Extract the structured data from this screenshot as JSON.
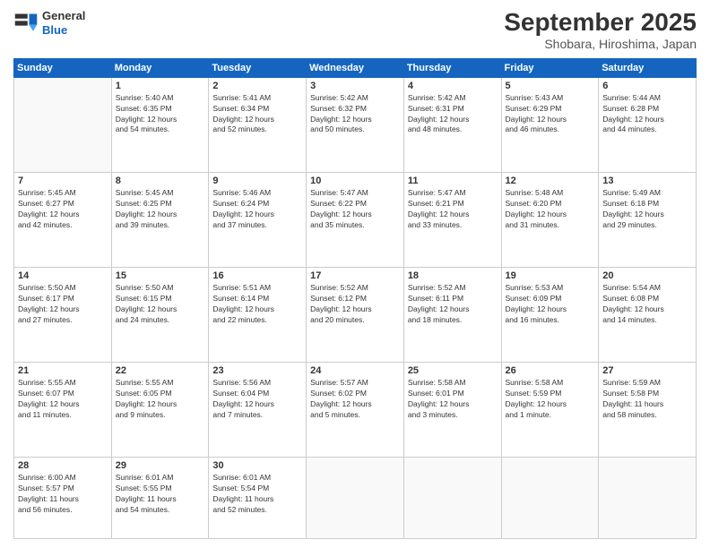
{
  "logo": {
    "line1": "General",
    "line2": "Blue"
  },
  "header": {
    "month": "September 2025",
    "location": "Shobara, Hiroshima, Japan"
  },
  "weekdays": [
    "Sunday",
    "Monday",
    "Tuesday",
    "Wednesday",
    "Thursday",
    "Friday",
    "Saturday"
  ],
  "weeks": [
    [
      {
        "day": "",
        "info": ""
      },
      {
        "day": "1",
        "info": "Sunrise: 5:40 AM\nSunset: 6:35 PM\nDaylight: 12 hours\nand 54 minutes."
      },
      {
        "day": "2",
        "info": "Sunrise: 5:41 AM\nSunset: 6:34 PM\nDaylight: 12 hours\nand 52 minutes."
      },
      {
        "day": "3",
        "info": "Sunrise: 5:42 AM\nSunset: 6:32 PM\nDaylight: 12 hours\nand 50 minutes."
      },
      {
        "day": "4",
        "info": "Sunrise: 5:42 AM\nSunset: 6:31 PM\nDaylight: 12 hours\nand 48 minutes."
      },
      {
        "day": "5",
        "info": "Sunrise: 5:43 AM\nSunset: 6:29 PM\nDaylight: 12 hours\nand 46 minutes."
      },
      {
        "day": "6",
        "info": "Sunrise: 5:44 AM\nSunset: 6:28 PM\nDaylight: 12 hours\nand 44 minutes."
      }
    ],
    [
      {
        "day": "7",
        "info": "Sunrise: 5:45 AM\nSunset: 6:27 PM\nDaylight: 12 hours\nand 42 minutes."
      },
      {
        "day": "8",
        "info": "Sunrise: 5:45 AM\nSunset: 6:25 PM\nDaylight: 12 hours\nand 39 minutes."
      },
      {
        "day": "9",
        "info": "Sunrise: 5:46 AM\nSunset: 6:24 PM\nDaylight: 12 hours\nand 37 minutes."
      },
      {
        "day": "10",
        "info": "Sunrise: 5:47 AM\nSunset: 6:22 PM\nDaylight: 12 hours\nand 35 minutes."
      },
      {
        "day": "11",
        "info": "Sunrise: 5:47 AM\nSunset: 6:21 PM\nDaylight: 12 hours\nand 33 minutes."
      },
      {
        "day": "12",
        "info": "Sunrise: 5:48 AM\nSunset: 6:20 PM\nDaylight: 12 hours\nand 31 minutes."
      },
      {
        "day": "13",
        "info": "Sunrise: 5:49 AM\nSunset: 6:18 PM\nDaylight: 12 hours\nand 29 minutes."
      }
    ],
    [
      {
        "day": "14",
        "info": "Sunrise: 5:50 AM\nSunset: 6:17 PM\nDaylight: 12 hours\nand 27 minutes."
      },
      {
        "day": "15",
        "info": "Sunrise: 5:50 AM\nSunset: 6:15 PM\nDaylight: 12 hours\nand 24 minutes."
      },
      {
        "day": "16",
        "info": "Sunrise: 5:51 AM\nSunset: 6:14 PM\nDaylight: 12 hours\nand 22 minutes."
      },
      {
        "day": "17",
        "info": "Sunrise: 5:52 AM\nSunset: 6:12 PM\nDaylight: 12 hours\nand 20 minutes."
      },
      {
        "day": "18",
        "info": "Sunrise: 5:52 AM\nSunset: 6:11 PM\nDaylight: 12 hours\nand 18 minutes."
      },
      {
        "day": "19",
        "info": "Sunrise: 5:53 AM\nSunset: 6:09 PM\nDaylight: 12 hours\nand 16 minutes."
      },
      {
        "day": "20",
        "info": "Sunrise: 5:54 AM\nSunset: 6:08 PM\nDaylight: 12 hours\nand 14 minutes."
      }
    ],
    [
      {
        "day": "21",
        "info": "Sunrise: 5:55 AM\nSunset: 6:07 PM\nDaylight: 12 hours\nand 11 minutes."
      },
      {
        "day": "22",
        "info": "Sunrise: 5:55 AM\nSunset: 6:05 PM\nDaylight: 12 hours\nand 9 minutes."
      },
      {
        "day": "23",
        "info": "Sunrise: 5:56 AM\nSunset: 6:04 PM\nDaylight: 12 hours\nand 7 minutes."
      },
      {
        "day": "24",
        "info": "Sunrise: 5:57 AM\nSunset: 6:02 PM\nDaylight: 12 hours\nand 5 minutes."
      },
      {
        "day": "25",
        "info": "Sunrise: 5:58 AM\nSunset: 6:01 PM\nDaylight: 12 hours\nand 3 minutes."
      },
      {
        "day": "26",
        "info": "Sunrise: 5:58 AM\nSunset: 5:59 PM\nDaylight: 12 hours\nand 1 minute."
      },
      {
        "day": "27",
        "info": "Sunrise: 5:59 AM\nSunset: 5:58 PM\nDaylight: 11 hours\nand 58 minutes."
      }
    ],
    [
      {
        "day": "28",
        "info": "Sunrise: 6:00 AM\nSunset: 5:57 PM\nDaylight: 11 hours\nand 56 minutes."
      },
      {
        "day": "29",
        "info": "Sunrise: 6:01 AM\nSunset: 5:55 PM\nDaylight: 11 hours\nand 54 minutes."
      },
      {
        "day": "30",
        "info": "Sunrise: 6:01 AM\nSunset: 5:54 PM\nDaylight: 11 hours\nand 52 minutes."
      },
      {
        "day": "",
        "info": ""
      },
      {
        "day": "",
        "info": ""
      },
      {
        "day": "",
        "info": ""
      },
      {
        "day": "",
        "info": ""
      }
    ]
  ]
}
